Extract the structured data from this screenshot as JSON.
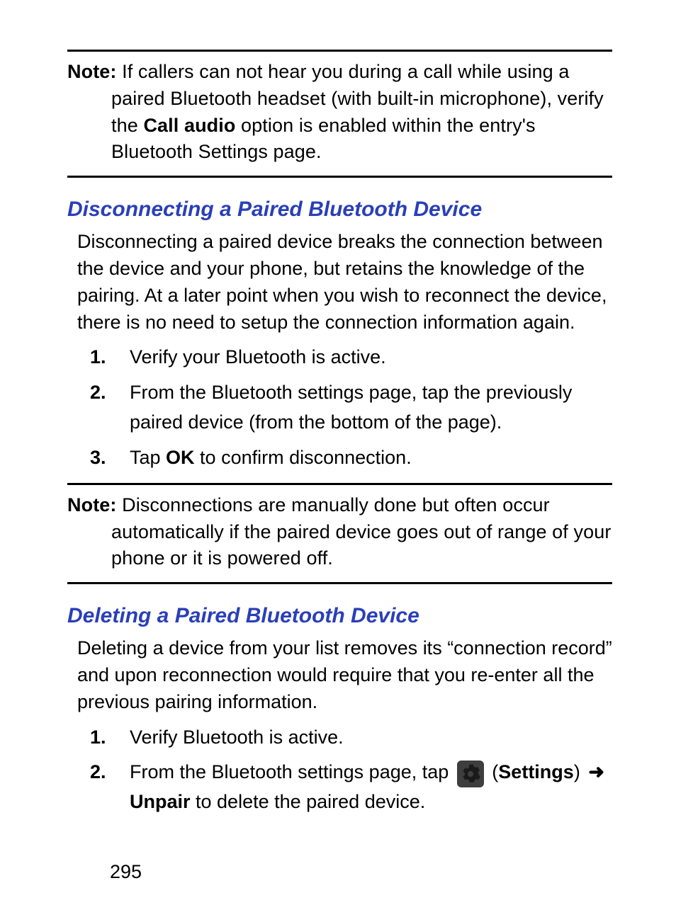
{
  "page_number": "295",
  "note1": {
    "label": "Note:",
    "t1": "If callers can not hear you during a call while using a paired Bluetooth headset (with built-in microphone), verify the ",
    "bold1": "Call audio",
    "t2": " option is enabled within the entry's Bluetooth Settings page."
  },
  "section1": {
    "heading": "Disconnecting a Paired Bluetooth Device",
    "intro": "Disconnecting a paired device breaks the connection between the device and your phone, but retains the knowledge of the pairing. At a later point when you wish to reconnect the device, there is no need to setup the connection information again.",
    "steps": [
      {
        "n": "1.",
        "t": "Verify your Bluetooth is active."
      },
      {
        "n": "2.",
        "t": "From the Bluetooth settings page, tap the previously paired device (from the bottom of the page)."
      },
      {
        "n": "3.",
        "t_pre": "Tap ",
        "bold": "OK",
        "t_post": " to confirm disconnection."
      }
    ]
  },
  "note2": {
    "label": "Note:",
    "t": "Disconnections are manually done but often occur automatically if the paired device goes out of range of your phone or it is powered off."
  },
  "section2": {
    "heading": "Deleting a Paired Bluetooth Device",
    "intro": "Deleting a device from your list removes its “connection record” and upon reconnection would require that you re-enter all the previous pairing information.",
    "steps": [
      {
        "n": "1.",
        "t": "Verify Bluetooth is active."
      },
      {
        "n": "2.",
        "t_pre": "From the Bluetooth settings page, tap ",
        "icon": "settings-gear",
        "paren_open": " (",
        "bold1": "Settings",
        "paren_close": ") ",
        "arrow": "➜",
        "bold2": "Unpair",
        "t_post": " to delete the paired device."
      }
    ]
  }
}
